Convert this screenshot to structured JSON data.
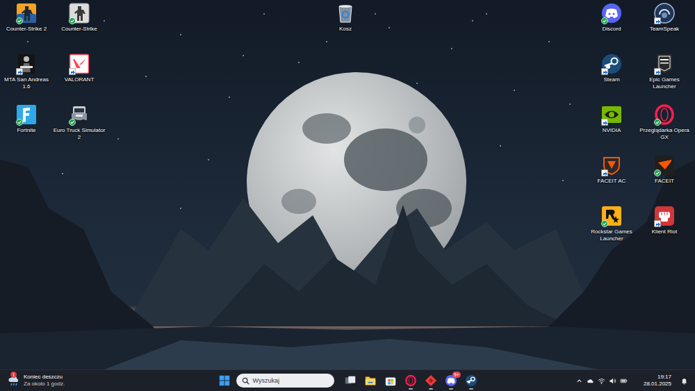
{
  "desktop": {
    "left_icons": [
      {
        "label": "Counter-Strike 2",
        "kind": "cs2",
        "overlay": "sync"
      },
      {
        "label": "Counter-Strike",
        "kind": "cs",
        "overlay": "sync"
      },
      {
        "label": "MTA San Andreas 1.6",
        "kind": "mta",
        "overlay": "shortcut"
      },
      {
        "label": "VALORANT",
        "kind": "valorant",
        "overlay": "shortcut"
      },
      {
        "label": "Fortnite",
        "kind": "fortnite",
        "overlay": "sync"
      },
      {
        "label": "Euro Truck Simulator 2",
        "kind": "ets2",
        "overlay": "sync"
      }
    ],
    "center_icons": [
      {
        "label": "Kosz",
        "kind": "bin",
        "overlay": "none"
      }
    ],
    "right_icons": [
      {
        "label": "Discord",
        "kind": "discord",
        "overlay": "sync"
      },
      {
        "label": "TeamSpeak",
        "kind": "teamspeak",
        "overlay": "shortcut"
      },
      {
        "label": "Steam",
        "kind": "steam",
        "overlay": "shortcut"
      },
      {
        "label": "Epic Games Launcher",
        "kind": "epic",
        "overlay": "shortcut"
      },
      {
        "label": "NVIDIA",
        "kind": "nvidia",
        "overlay": "shortcut"
      },
      {
        "label": "Przeglądarka Opera GX",
        "kind": "opera",
        "overlay": "sync"
      },
      {
        "label": "FACEIT AC",
        "kind": "faceitac",
        "overlay": "shortcut"
      },
      {
        "label": "FACEIT",
        "kind": "faceit",
        "overlay": "sync"
      },
      {
        "label": "Rockstar Games Launcher",
        "kind": "rockstar",
        "overlay": "sync"
      },
      {
        "label": "Klient Riot",
        "kind": "riot",
        "overlay": "shortcut"
      }
    ]
  },
  "taskbar": {
    "weather": {
      "title": "Koniec deszczu",
      "subtitle": "Za około 1 godz.",
      "badge": "1"
    },
    "search": {
      "placeholder": "Wyszukaj"
    },
    "apps": [
      {
        "kind": "task-view",
        "running": false
      },
      {
        "kind": "explorer",
        "running": false
      },
      {
        "kind": "store",
        "running": false
      },
      {
        "kind": "opera",
        "running": true
      },
      {
        "kind": "diamond",
        "running": true
      },
      {
        "kind": "discord",
        "running": true,
        "badge": "9+"
      },
      {
        "kind": "steam",
        "running": true
      }
    ],
    "clock": {
      "time": "19:17",
      "date": "28.01.2025"
    }
  }
}
